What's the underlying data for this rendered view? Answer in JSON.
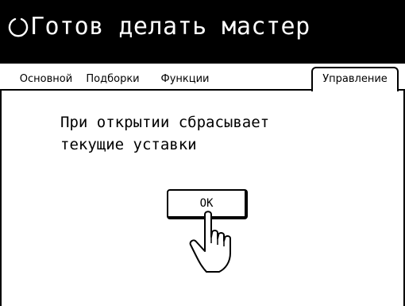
{
  "header": {
    "status_text": "Готов делать мастер",
    "status_icon": "circle-status-icon"
  },
  "tabs": [
    {
      "label": "Основной",
      "active": false
    },
    {
      "label": "Подборки",
      "active": false
    },
    {
      "label": "Функции",
      "active": false
    },
    {
      "label": "Управление",
      "active": true
    }
  ],
  "dialog": {
    "message_line1": "При открытии сбрасывает",
    "message_line2": "текущие уставки",
    "ok_label": "ОК"
  },
  "icons": {
    "pointer": "hand-pointer-icon"
  },
  "colors": {
    "header_bg": "#000000",
    "header_text": "#ffffff",
    "page_bg": "#ffffff"
  }
}
